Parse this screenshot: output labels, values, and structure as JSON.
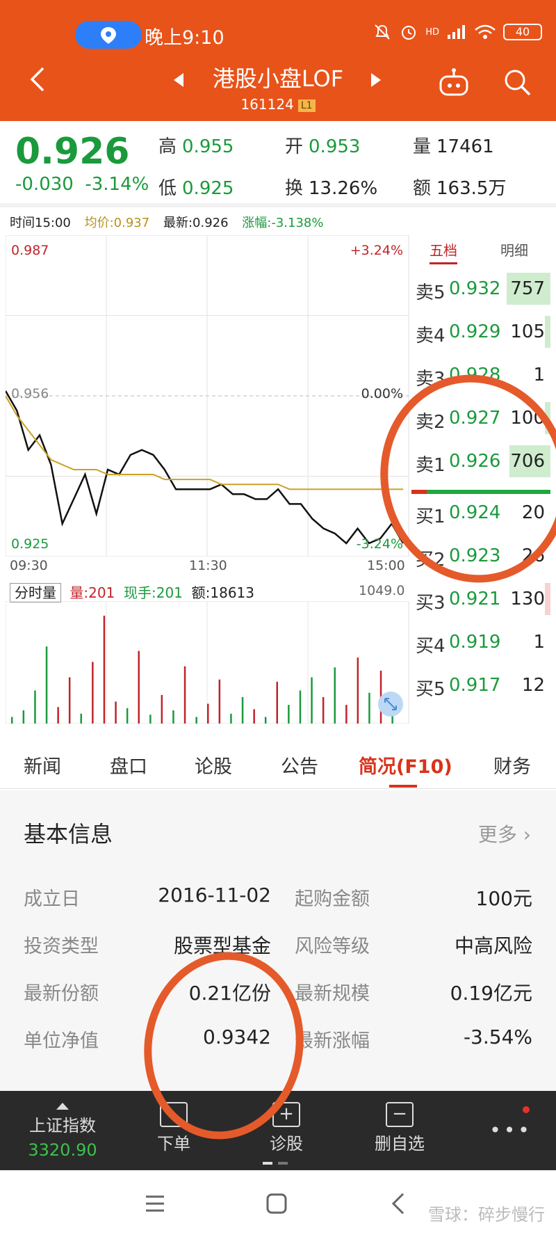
{
  "status_bar": {
    "time": "晚上9:10",
    "battery": "40",
    "network": "HD"
  },
  "header": {
    "title": "港股小盘LOF",
    "code": "161124",
    "level_badge": "L1",
    "back_icon": "chevron-left-icon",
    "prev_icon": "triangle-left-icon",
    "next_icon": "triangle-right-icon",
    "robot_icon": "robot-icon",
    "search_icon": "search-icon"
  },
  "quote": {
    "price": "0.926",
    "change": "-0.030",
    "change_pct": "-3.14%",
    "high_label": "高",
    "high": "0.955",
    "low_label": "低",
    "low": "0.925",
    "open_label": "开",
    "open": "0.953",
    "turnover_label": "换",
    "turnover": "13.26%",
    "volume_label": "量",
    "volume": "17461",
    "amount_label": "额",
    "amount": "163.5万"
  },
  "chart_header": {
    "time": "时间15:00",
    "avg": "均价:0.937",
    "latest": "最新:0.926",
    "change": "涨幅:-3.138%"
  },
  "chart_labels": {
    "y_top": "0.987",
    "y_mid": "0.956",
    "y_bottom": "0.925",
    "pct_top": "+3.24%",
    "pct_mid": "0.00%",
    "pct_bottom": "-3.24%",
    "x_start": "09:30",
    "x_mid": "11:30",
    "x_end": "15:00"
  },
  "chart_data": {
    "type": "line",
    "x": [
      "09:30",
      "11:30",
      "15:00"
    ],
    "ylim": [
      0.925,
      0.987
    ],
    "series": [
      {
        "name": "",
        "color": "#111111",
        "values": [
          0.957,
          0.953,
          0.945,
          0.948,
          0.942,
          0.93,
          0.935,
          0.94,
          0.932,
          0.941,
          0.94,
          0.944,
          0.945,
          0.944,
          0.941,
          0.937,
          0.937,
          0.937,
          0.937,
          0.938,
          0.936,
          0.936,
          0.935,
          0.935,
          0.937,
          0.934,
          0.934,
          0.931,
          0.929,
          0.928,
          0.926,
          0.929,
          0.926,
          0.927,
          0.93,
          0.926
        ]
      },
      {
        "name": "",
        "color": "#c9a227",
        "values": [
          0.956,
          0.952,
          0.949,
          0.946,
          0.943,
          0.942,
          0.941,
          0.941,
          0.941,
          0.94,
          0.94,
          0.94,
          0.94,
          0.94,
          0.939,
          0.939,
          0.939,
          0.939,
          0.939,
          0.938,
          0.938,
          0.938,
          0.938,
          0.938,
          0.938,
          0.937,
          0.937,
          0.937,
          0.937,
          0.937,
          0.937,
          0.937,
          0.937,
          0.937,
          0.937,
          0.937
        ]
      }
    ]
  },
  "volume_chart": {
    "tab_label": "分时量",
    "vol": "量:201",
    "hand": "现手:201",
    "amount": "额:18613",
    "max": "1049.0",
    "bars": [
      {
        "v": 60,
        "c": "g"
      },
      {
        "v": 120,
        "c": "g"
      },
      {
        "v": 300,
        "c": "g"
      },
      {
        "v": 700,
        "c": "g"
      },
      {
        "v": 150,
        "c": "r"
      },
      {
        "v": 420,
        "c": "r"
      },
      {
        "v": 90,
        "c": "g"
      },
      {
        "v": 560,
        "c": "r"
      },
      {
        "v": 980,
        "c": "r"
      },
      {
        "v": 200,
        "c": "r"
      },
      {
        "v": 140,
        "c": "g"
      },
      {
        "v": 660,
        "c": "r"
      },
      {
        "v": 80,
        "c": "g"
      },
      {
        "v": 260,
        "c": "r"
      },
      {
        "v": 120,
        "c": "g"
      },
      {
        "v": 520,
        "c": "r"
      },
      {
        "v": 60,
        "c": "g"
      },
      {
        "v": 180,
        "c": "r"
      },
      {
        "v": 400,
        "c": "r"
      },
      {
        "v": 90,
        "c": "g"
      },
      {
        "v": 240,
        "c": "g"
      },
      {
        "v": 130,
        "c": "r"
      },
      {
        "v": 60,
        "c": "g"
      },
      {
        "v": 380,
        "c": "r"
      },
      {
        "v": 170,
        "c": "g"
      },
      {
        "v": 300,
        "c": "g"
      },
      {
        "v": 420,
        "c": "g"
      },
      {
        "v": 240,
        "c": "r"
      },
      {
        "v": 510,
        "c": "g"
      },
      {
        "v": 170,
        "c": "r"
      },
      {
        "v": 600,
        "c": "r"
      },
      {
        "v": 280,
        "c": "g"
      },
      {
        "v": 480,
        "c": "r"
      },
      {
        "v": 200,
        "c": "g"
      }
    ]
  },
  "order_book": {
    "tabs": [
      "五档",
      "明细"
    ],
    "sells": [
      {
        "label": "卖5",
        "price": "0.932",
        "qty": "757",
        "bar": 0.9
      },
      {
        "label": "卖4",
        "price": "0.929",
        "qty": "105",
        "bar": 0.06
      },
      {
        "label": "卖3",
        "price": "0.928",
        "qty": "1",
        "bar": 0.0
      },
      {
        "label": "卖2",
        "price": "0.927",
        "qty": "100",
        "bar": 0.06
      },
      {
        "label": "卖1",
        "price": "0.926",
        "qty": "706",
        "bar": 0.85
      }
    ],
    "buys": [
      {
        "label": "买1",
        "price": "0.924",
        "qty": "20",
        "bar": 0.0
      },
      {
        "label": "买2",
        "price": "0.923",
        "qty": "26",
        "bar": 0.0
      },
      {
        "label": "买3",
        "price": "0.921",
        "qty": "130",
        "bar": 0.06
      },
      {
        "label": "买4",
        "price": "0.919",
        "qty": "1",
        "bar": 0.0
      },
      {
        "label": "买5",
        "price": "0.917",
        "qty": "12",
        "bar": 0.0
      }
    ]
  },
  "tabs": [
    "新闻",
    "盘口",
    "论股",
    "公告",
    "简况(F10)",
    "财务"
  ],
  "info": {
    "title": "基本信息",
    "more": "更多",
    "rows": [
      {
        "l1": "成立日",
        "v1": "2016-11-02",
        "l2": "起购金额",
        "v2": "100元"
      },
      {
        "l1": "投资类型",
        "v1": "股票型基金",
        "l2": "风险等级",
        "v2": "中高风险"
      },
      {
        "l1": "最新份额",
        "v1": "0.21亿份",
        "l2": "最新规模",
        "v2": "0.19亿元"
      },
      {
        "l1": "单位净值",
        "v1": "0.9342",
        "l2": "最新涨幅",
        "v2": "-3.54%"
      }
    ]
  },
  "toolbar": {
    "index_name": "上证指数",
    "index_value": "3320.90",
    "order": "下单",
    "diagnose": "诊股",
    "remove": "删自选"
  },
  "watermark": "雪球：碎步慢行"
}
